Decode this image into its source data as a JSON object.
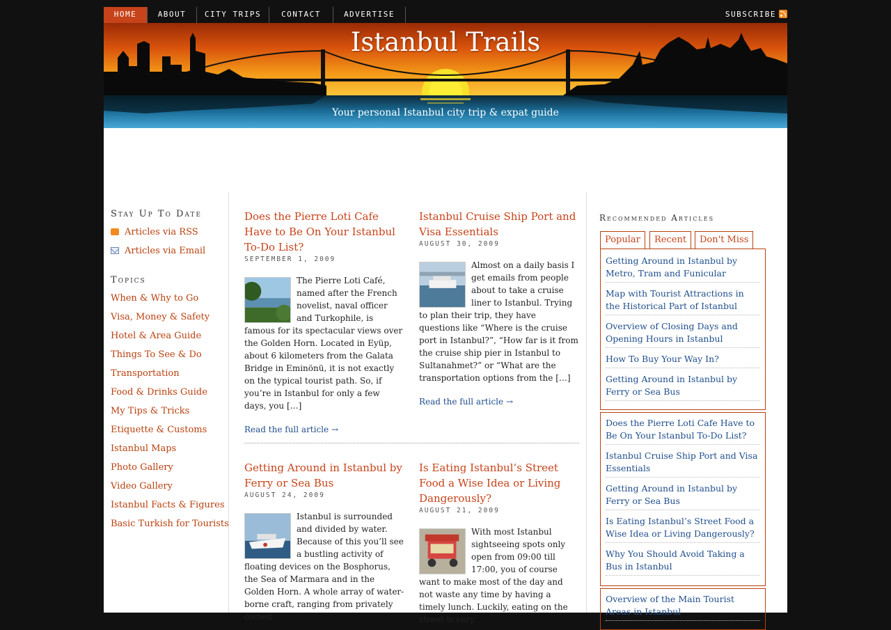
{
  "nav": {
    "items": [
      "HOME",
      "ABOUT",
      "CITY TRIPS",
      "CONTACT",
      "ADVERTISE"
    ],
    "subscribe": "SUBSCRIBE"
  },
  "banner": {
    "title": "Istanbul Trails",
    "tagline": "Your personal Istanbul city trip & expat guide"
  },
  "sidebar": {
    "stay_heading": "Stay Up To Date",
    "rss_link": "Articles via RSS",
    "email_link": "Articles via Email",
    "topics_heading": "Topics",
    "topics": [
      "When & Why to Go",
      "Visa, Money & Safety",
      "Hotel & Area Guide",
      "Things To See & Do",
      "Transportation",
      "Food & Drinks Guide",
      "My Tips & Tricks",
      "Etiquette & Customs",
      "Istanbul Maps",
      "Photo Gallery",
      "Video Gallery",
      "Istanbul Facts & Figures",
      "Basic Turkish for Tourists"
    ]
  },
  "posts": [
    {
      "title": "Does the Pierre Loti Cafe Have to Be On Your Istanbul To-Do List?",
      "date": "SEPTEMBER 1, 2009",
      "body": "The Pierre Loti Café, named after the French novelist, naval officer and Turkophile, is famous for its spectacular views over the Golden Horn. Located in Eyüp, about 6 kilometers from the Galata Bridge in Eminönü, it is not exactly on the typical tourist path. So, if you’re in Istanbul for only a few days, you […]",
      "read_more": "Read the full article →"
    },
    {
      "title": "Istanbul Cruise Ship Port and Visa Essentials",
      "date": "AUGUST 30, 2009",
      "body": "Almost on a daily basis I get emails from people about to take a cruise liner to Istanbul. Trying to plan their trip, they have questions like “Where is the cruise port in Istanbul?”, “How far is it from the cruise ship pier in Istanbul to Sultanahmet?” or “What are the transportation options from the […]",
      "read_more": "Read the full article →"
    },
    {
      "title": "Getting Around in Istanbul by Ferry or Sea Bus",
      "date": "AUGUST 24, 2009",
      "body": "Istanbul is surrounded and divided by water. Because of this you’ll see a bustling activity of floating devices on the Bosphorus, the Sea of Marmara and in the Golden Horn. A whole array of water-borne craft, ranging from privately owned",
      "read_more": ""
    },
    {
      "title": "Is Eating Istanbul’s Street Food a Wise Idea or Living Dangerously?",
      "date": "AUGUST 21, 2009",
      "body": "With most Istanbul sightseeing spots only open from 09:00 till 17:00, you of course want to make most of the day and not waste any time by having a timely lunch. Luckily, eating on the street is very",
      "read_more": ""
    }
  ],
  "recommended": {
    "heading": "Recommended Articles",
    "tabs": [
      "Popular",
      "Recent",
      "Don't Miss"
    ],
    "popular": [
      "Getting Around in Istanbul by Metro, Tram and Funicular",
      "Map with Tourist Attractions in the Historical Part of Istanbul",
      "Overview of Closing Days and Opening Hours in Istanbul",
      "How To Buy Your Way In?",
      "Getting Around in Istanbul by Ferry or Sea Bus"
    ],
    "recent": [
      "Does the Pierre Loti Cafe Have to Be On Your Istanbul To-Do List?",
      "Istanbul Cruise Ship Port and Visa Essentials",
      "Getting Around in Istanbul by Ferry or Sea Bus",
      "Is Eating Istanbul’s Street Food a Wise Idea or Living Dangerously?",
      "Why You Should Avoid Taking a Bus in Istanbul"
    ],
    "dont_miss": [
      "Overview of the Main Tourist Areas in Istanbul"
    ]
  },
  "colors": {
    "accent": "#c7431a",
    "link_blue": "#1f4e8c",
    "background": "#111111"
  }
}
